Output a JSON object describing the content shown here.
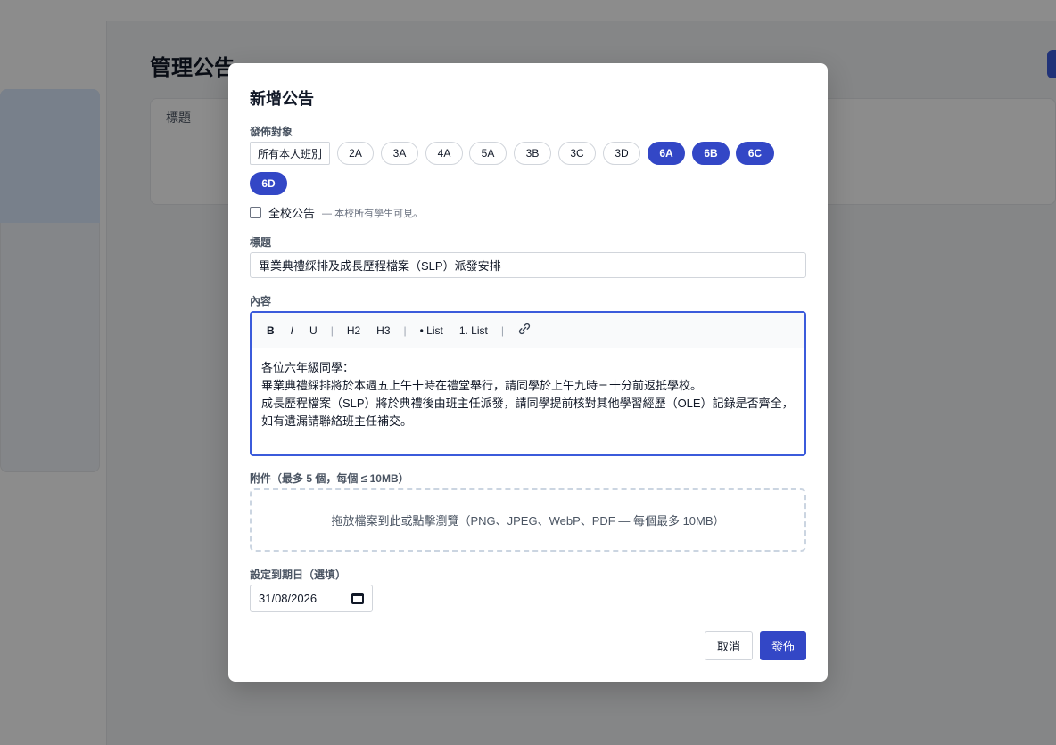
{
  "background": {
    "page_title": "管理公告",
    "card_label": "標題"
  },
  "modal": {
    "title": "新增公告",
    "audience": {
      "label": "發佈對象",
      "chips": [
        {
          "label": "所有本人班別",
          "selected": false
        },
        {
          "label": "2A",
          "selected": false
        },
        {
          "label": "3A",
          "selected": false
        },
        {
          "label": "4A",
          "selected": false
        },
        {
          "label": "5A",
          "selected": false
        },
        {
          "label": "3B",
          "selected": false
        },
        {
          "label": "3C",
          "selected": false
        },
        {
          "label": "3D",
          "selected": false
        },
        {
          "label": "6A",
          "selected": true
        },
        {
          "label": "6B",
          "selected": true
        },
        {
          "label": "6C",
          "selected": true
        },
        {
          "label": "6D",
          "selected": true
        }
      ]
    },
    "whole_school": {
      "label": "全校公告",
      "hint": "— 本校所有學生可見。",
      "checked": false
    },
    "title_field": {
      "label": "標題",
      "value": "畢業典禮綵排及成長歷程檔案（SLP）派發安排"
    },
    "content_field": {
      "label": "內容",
      "toolbar": [
        "B",
        "I",
        "U",
        "H2",
        "H3",
        "• List",
        "1. List",
        "link-icon"
      ],
      "lines": [
        "各位六年級同學：",
        "畢業典禮綵排將於本週五上午十時在禮堂舉行，請同學於上午九時三十分前返抵學校。",
        "成長歷程檔案（SLP）將於典禮後由班主任派發，請同學提前核對其他學習經歷（OLE）記錄是否齊全，如有遺漏請聯絡班主任補交。"
      ]
    },
    "attachments": {
      "label": "附件（最多 5 個，每個 ≤ 10MB）",
      "dropzone_text": "拖放檔案到此或點擊瀏覽（PNG、JPEG、WebP、PDF — 每個最多 10MB）"
    },
    "expiry": {
      "label": "設定到期日（選填）",
      "value": "31/08/2026"
    },
    "buttons": {
      "cancel": "取消",
      "publish": "發佈"
    },
    "colors": {
      "accent": "#3347c6"
    }
  }
}
